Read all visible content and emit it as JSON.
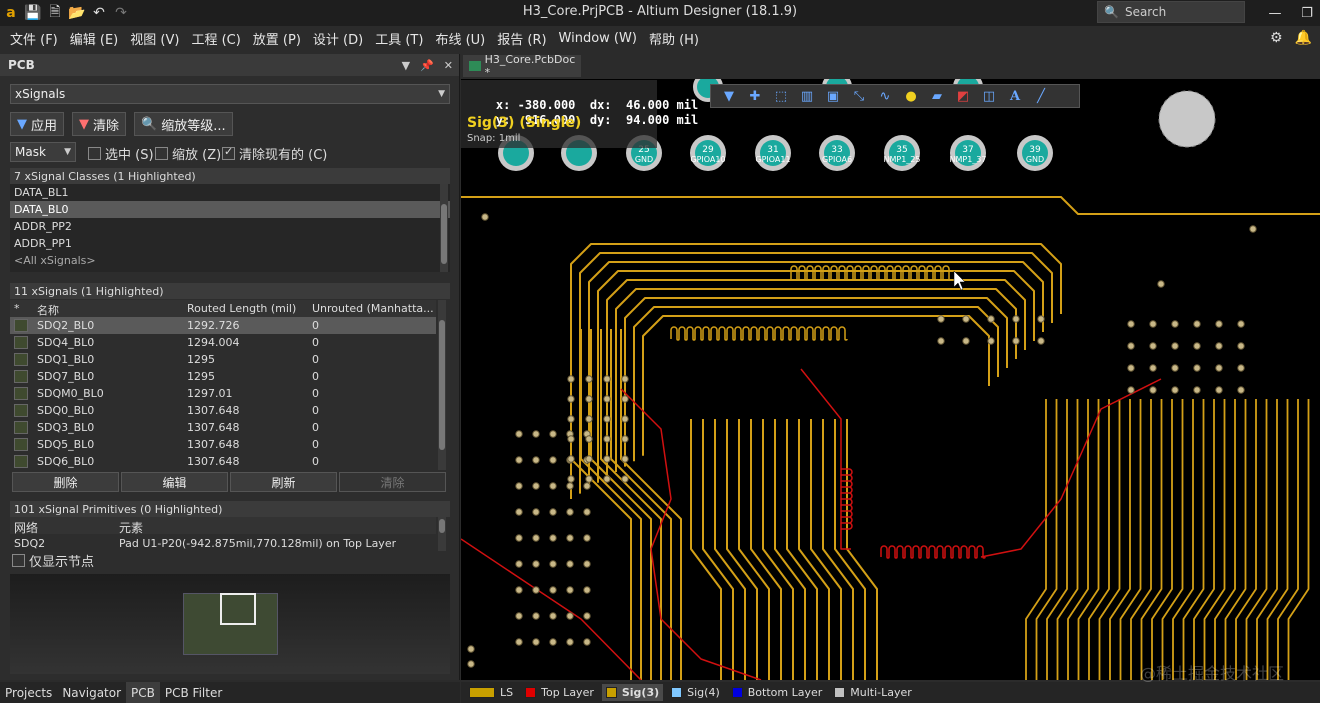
{
  "window": {
    "title": "H3_Core.PrjPCB - Altium Designer (18.1.9)",
    "search_placeholder": "Search"
  },
  "menu": [
    "文件 (F)",
    "编辑 (E)",
    "视图 (V)",
    "工程 (C)",
    "放置 (P)",
    "设计 (D)",
    "工具 (T)",
    "布线 (U)",
    "报告 (R)",
    "Window (W)",
    "帮助 (H)"
  ],
  "panel": {
    "title": "PCB",
    "mode_select": "xSignals",
    "apply_label": "应用",
    "clear_label": "清除",
    "zoom_level_label": "缩放等级...",
    "mask_select": "Mask",
    "select_label": "选中 (S)",
    "zoom_label": "缩放 (Z)",
    "clear_existing_label": "清除现有的 (C)",
    "classes_header": "7 xSignal Classes (1 Highlighted)",
    "classes": [
      "DATA_BL1",
      "DATA_BL0",
      "ADDR_PP2",
      "ADDR_PP1",
      "<All xSignals>"
    ],
    "selected_class_index": 1,
    "signals_header": "11 xSignals (1 Highlighted)",
    "signals_columns": [
      "*",
      "名称",
      "Routed Length (mil)",
      "Unrouted (Manhatta..."
    ],
    "signals": [
      {
        "name": "SDQ2_BL0",
        "routed": "1292.726",
        "unrouted": "0"
      },
      {
        "name": "SDQ4_BL0",
        "routed": "1294.004",
        "unrouted": "0"
      },
      {
        "name": "SDQ1_BL0",
        "routed": "1295",
        "unrouted": "0"
      },
      {
        "name": "SDQ7_BL0",
        "routed": "1295",
        "unrouted": "0"
      },
      {
        "name": "SDQM0_BL0",
        "routed": "1297.01",
        "unrouted": "0"
      },
      {
        "name": "SDQ0_BL0",
        "routed": "1307.648",
        "unrouted": "0"
      },
      {
        "name": "SDQ3_BL0",
        "routed": "1307.648",
        "unrouted": "0"
      },
      {
        "name": "SDQ5_BL0",
        "routed": "1307.648",
        "unrouted": "0"
      },
      {
        "name": "SDQ6_BL0",
        "routed": "1307.648",
        "unrouted": "0"
      }
    ],
    "delete_label": "删除",
    "edit_label": "编辑",
    "refresh_label": "刷新",
    "clear2_label": "清除",
    "primitives_header": "101 xSignal Primitives (0 Highlighted)",
    "primitives_columns": [
      "网络",
      "元素"
    ],
    "primitives": [
      {
        "net": "SDQ2",
        "element": "Pad U1-P20(-942.875mil,770.128mil) on Top Layer"
      }
    ],
    "show_nodes_label": "仅显示节点"
  },
  "bottom_tabs": [
    "Projects",
    "Navigator",
    "PCB",
    "PCB Filter"
  ],
  "active_bottom_tab": "PCB",
  "document_tab": "H3_Core.PcbDoc *",
  "coords": {
    "x_label": "x:",
    "x_value": "-380.000",
    "dx_label": "dx:",
    "dx_value": "46.000 mil",
    "y_label": "y:",
    "y_value": "916.000",
    "dy_label": "dy:",
    "dy_value": "94.000 mil",
    "layer_status": "Sig(3) (Single)",
    "snap": "Snap: 1mil"
  },
  "pads_top": [
    {
      "num": "25",
      "net": "GND"
    },
    {
      "num": "29",
      "net": "GPIOA10"
    },
    {
      "num": "31",
      "net": "GPIOA11"
    },
    {
      "num": "33",
      "net": "GPIOA6"
    },
    {
      "num": "35",
      "net": "NMP1_25"
    },
    {
      "num": "37",
      "net": "NMP1_37"
    },
    {
      "num": "39",
      "net": "GND"
    }
  ],
  "layers": [
    {
      "name": "LS",
      "color": "#c8a000"
    },
    {
      "name": "Top Layer",
      "color": "#e00000"
    },
    {
      "name": "Sig(3)",
      "color": "#c8a000"
    },
    {
      "name": "Sig(4)",
      "color": "#80c8ff"
    },
    {
      "name": "Bottom Layer",
      "color": "#0000e0"
    },
    {
      "name": "Multi-Layer",
      "color": "#c0c0c0"
    }
  ],
  "active_layer": "Sig(3)",
  "colors": {
    "trace": "#d4a017",
    "top_trace": "#d01010",
    "pad_teal": "#1aa99e",
    "via": "#c8b888",
    "background": "#000000"
  },
  "watermark": "@稀土掘金技术社区"
}
